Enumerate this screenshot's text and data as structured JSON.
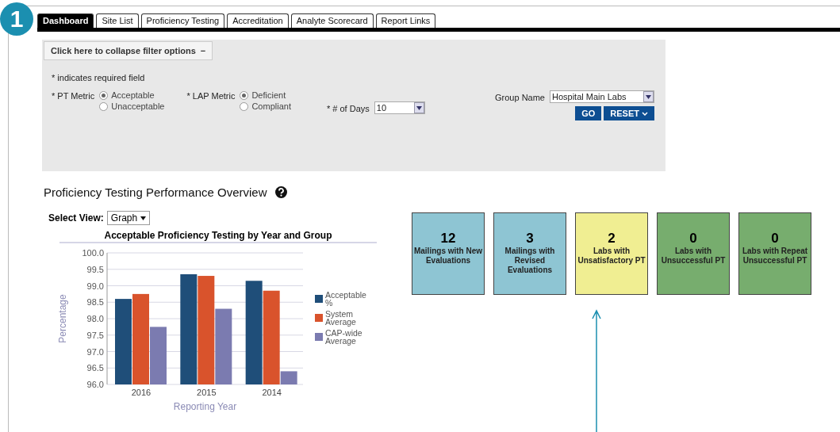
{
  "step_badge": "1",
  "tabs": [
    {
      "label": "Dashboard",
      "selected": true
    },
    {
      "label": "Site List",
      "selected": false
    },
    {
      "label": "Proficiency Testing",
      "selected": false
    },
    {
      "label": "Accreditation",
      "selected": false
    },
    {
      "label": "Analyte Scorecard",
      "selected": false
    },
    {
      "label": "Report Links",
      "selected": false
    }
  ],
  "filter": {
    "collapse_button": "Click here to collapse filter options",
    "collapse_icon": "−",
    "required_note": "* indicates required field",
    "pt_metric": {
      "label": "PT Metric",
      "required_mark": "*",
      "options": [
        {
          "label": "Acceptable",
          "selected": true
        },
        {
          "label": "Unacceptable",
          "selected": false
        }
      ]
    },
    "lap_metric": {
      "label": "LAP Metric",
      "required_mark": "*",
      "options": [
        {
          "label": "Deficient",
          "selected": true
        },
        {
          "label": "Compliant",
          "selected": false
        }
      ]
    },
    "days": {
      "label": "# of Days",
      "required_mark": "*",
      "value": "10"
    },
    "group_name": {
      "label": "Group Name",
      "value": "Hospital Main Labs"
    },
    "go_button": "GO",
    "reset_button": "RESET"
  },
  "overview": {
    "title": "Proficiency Testing Performance Overview",
    "select_view": {
      "label": "Select View:",
      "value": "Graph"
    },
    "chart_data": {
      "type": "bar",
      "title": "Acceptable Proficiency Testing by Year and Group",
      "xlabel": "Reporting Year",
      "ylabel": "Percentage",
      "categories": [
        "2016",
        "2015",
        "2014"
      ],
      "series": [
        {
          "name": "Acceptable %",
          "color": "#1f4e79",
          "values": [
            98.6,
            99.35,
            99.15
          ]
        },
        {
          "name": "System Average",
          "color": "#d9532c",
          "values": [
            98.75,
            99.3,
            98.85
          ]
        },
        {
          "name": "CAP-wide Average",
          "color": "#7b7bb0",
          "values": [
            97.75,
            98.3,
            96.4
          ]
        }
      ],
      "grid": true,
      "legend": true,
      "ylim": [
        96,
        100
      ],
      "yticks": [
        {
          "value": 96,
          "label": "96.0"
        },
        {
          "value": 96.5,
          "label": "96.5"
        },
        {
          "value": 97,
          "label": "97.0"
        },
        {
          "value": 97.5,
          "label": "97.5"
        },
        {
          "value": 98,
          "label": "98.0"
        },
        {
          "value": 98.5,
          "label": "98.5"
        },
        {
          "value": 99,
          "label": "99.0"
        },
        {
          "value": 99.5,
          "label": "99.5"
        },
        {
          "value": 100,
          "label": "100.0"
        }
      ]
    },
    "tiles": [
      {
        "count": "12",
        "label": "Mailings with New Evaluations",
        "color": "#8ec5d3"
      },
      {
        "count": "3",
        "label": "Mailings with Revised Evaluations",
        "color": "#8ec5d3"
      },
      {
        "count": "2",
        "label": "Labs with Unsatisfactory PT",
        "color": "#f0ee92"
      },
      {
        "count": "0",
        "label": "Labs with Unsuccessful PT",
        "color": "#77ad6e"
      },
      {
        "count": "0",
        "label": "Labs with Repeat Unsuccessful PT",
        "color": "#77ad6e"
      }
    ]
  }
}
